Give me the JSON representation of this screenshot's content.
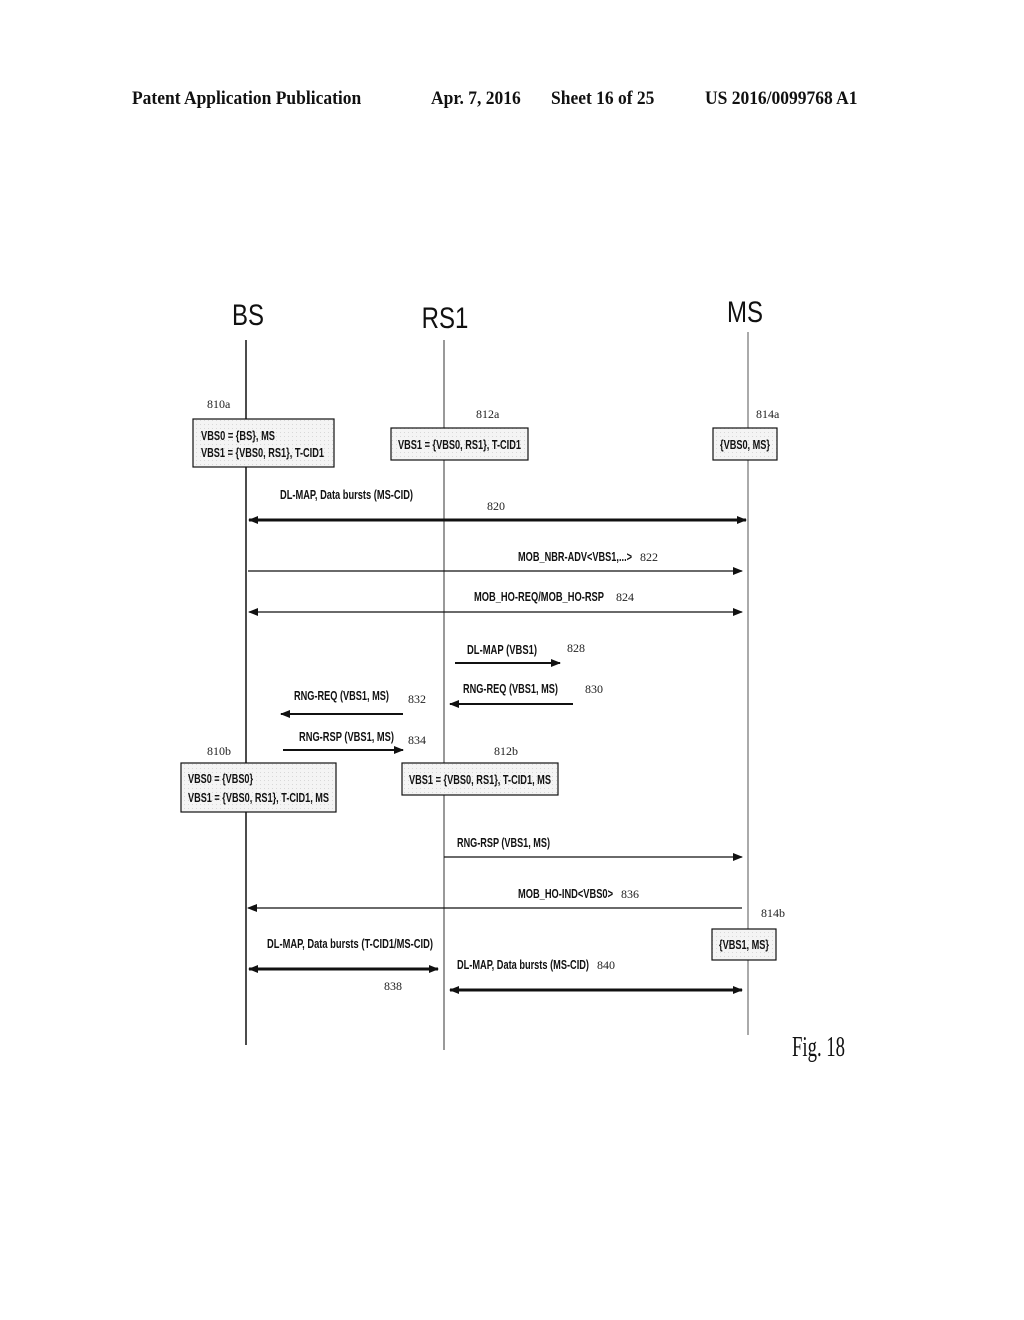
{
  "header": {
    "publication": "Patent Application Publication",
    "date": "Apr. 7, 2016",
    "sheet": "Sheet 16 of 25",
    "number": "US 2016/0099768 A1"
  },
  "figure_label": "Fig. 18",
  "colors": {
    "ink": "#111111",
    "box_fill": "#f2f2f2"
  },
  "actors": [
    {
      "id": "BS",
      "label": "BS"
    },
    {
      "id": "RS1",
      "label": "RS1"
    },
    {
      "id": "MS",
      "label": "MS"
    }
  ],
  "state_boxes": [
    {
      "ref": "810a",
      "actor": "BS",
      "lines": [
        "VBS0 = {BS}, MS",
        "VBS1 = {VBS0, RS1}, T-CID1"
      ]
    },
    {
      "ref": "812a",
      "actor": "RS1",
      "lines": [
        "VBS1 = {VBS0, RS1}, T-CID1"
      ]
    },
    {
      "ref": "814a",
      "actor": "MS",
      "lines": [
        "{VBS0, MS}"
      ]
    },
    {
      "ref": "810b",
      "actor": "BS",
      "lines": [
        "VBS0 = {VBS0}",
        "VBS1 = {VBS0, RS1}, T-CID1, MS"
      ]
    },
    {
      "ref": "812b",
      "actor": "RS1",
      "lines": [
        "VBS1 = {VBS0, RS1}, T-CID1, MS"
      ]
    },
    {
      "ref": "814b",
      "actor": "MS",
      "lines": [
        "{VBS1, MS}"
      ]
    }
  ],
  "messages": [
    {
      "ref": "820",
      "label": "DL-MAP, Data bursts (MS-CID)",
      "from": "BS",
      "to": "MS",
      "direction": "both",
      "bold": true
    },
    {
      "ref": "822",
      "label": "MOB_NBR-ADV<VBS1,...>",
      "from": "BS",
      "to": "MS",
      "direction": "right",
      "bold": false
    },
    {
      "ref": "824",
      "label": "MOB_HO-REQ/MOB_HO-RSP",
      "from": "BS",
      "to": "MS",
      "direction": "both",
      "bold": false
    },
    {
      "ref": "828",
      "label": "DL-MAP (VBS1)",
      "from": "RS1",
      "to": "",
      "direction": "right",
      "bold": true
    },
    {
      "ref": "830",
      "label": "RNG-REQ (VBS1, MS)",
      "from": "",
      "to": "RS1",
      "direction": "left",
      "bold": true
    },
    {
      "ref": "832",
      "label": "RNG-REQ (VBS1, MS)",
      "from": "",
      "to": "BS",
      "direction": "left",
      "bold": true
    },
    {
      "ref": "834",
      "label": "RNG-RSP (VBS1, MS)",
      "from": "BS",
      "to": "",
      "direction": "right",
      "bold": true
    },
    {
      "ref": "",
      "label": "RNG-RSP (VBS1, MS)",
      "from": "RS1",
      "to": "MS",
      "direction": "right",
      "bold": false
    },
    {
      "ref": "836",
      "label": "MOB_HO-IND<VBS0>",
      "from": "MS",
      "to": "BS",
      "direction": "left",
      "bold": false
    },
    {
      "ref": "838",
      "label": "DL-MAP, Data bursts (T-CID1/MS-CID)",
      "from": "BS",
      "to": "RS1",
      "direction": "both",
      "bold": true
    },
    {
      "ref": "840",
      "label": "DL-MAP, Data bursts (MS-CID)",
      "from": "RS1",
      "to": "MS",
      "direction": "both",
      "bold": true
    }
  ]
}
